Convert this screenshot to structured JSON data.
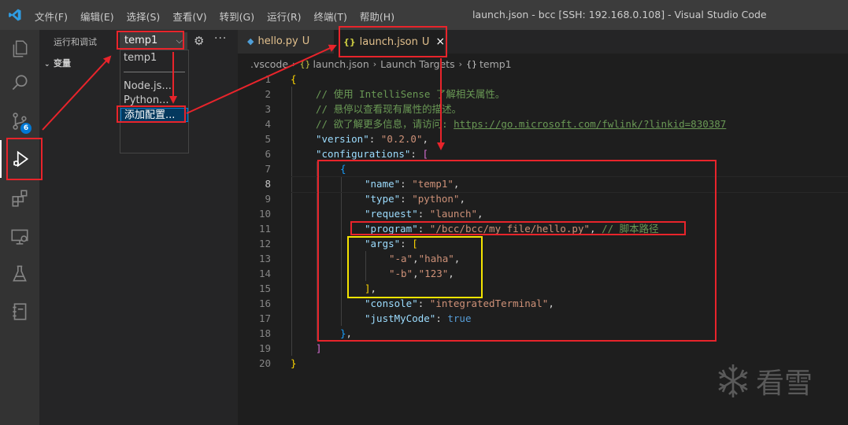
{
  "titlebar": {
    "menu": [
      "文件(F)",
      "编辑(E)",
      "选择(S)",
      "查看(V)",
      "转到(G)",
      "运行(R)",
      "终端(T)",
      "帮助(H)"
    ],
    "window_title": "launch.json - bcc [SSH: 192.168.0.108] - Visual Studio Code"
  },
  "activity_bar": {
    "items": [
      "explorer-icon",
      "search-icon",
      "source-control-icon",
      "run-debug-icon",
      "extensions-icon",
      "remote-explorer-icon",
      "testing-icon",
      "notebook-icon"
    ],
    "source_control_badge": "6"
  },
  "sidebar": {
    "title": "运行和调试",
    "config_selected": "temp1",
    "variables_section": "变量",
    "dropdown": {
      "items": [
        "temp1",
        "Node.js...",
        "Python...",
        "添加配置..."
      ]
    }
  },
  "tabs": [
    {
      "icon": "python-icon",
      "label": "hello.py",
      "status": "U"
    },
    {
      "icon": "json-icon",
      "label": "launch.json",
      "status": "U",
      "close": "×"
    }
  ],
  "breadcrumb": [
    ".vscode",
    "launch.json",
    "Launch Targets",
    "temp1"
  ],
  "editor": {
    "line_numbers": [
      "1",
      "2",
      "3",
      "4",
      "5",
      "6",
      "7",
      "8",
      "9",
      "10",
      "11",
      "12",
      "13",
      "14",
      "15",
      "16",
      "17",
      "18",
      "19",
      "20"
    ],
    "lines": {
      "l1": "{",
      "l2": "// 使用 IntelliSense 了解相关属性。",
      "l3": "// 悬停以查看现有属性的描述。",
      "l4_comment": "// 欲了解更多信息，请访问: ",
      "l4_link": "https://go.microsoft.com/fwlink/?linkid=830387",
      "version_key": "\"version\"",
      "version_val": "\"0.2.0\"",
      "configurations_key": "\"configurations\"",
      "open_bracket": "[",
      "l7": "{",
      "name_key": "\"name\"",
      "name_val": "\"temp1\"",
      "type_key": "\"type\"",
      "type_val": "\"python\"",
      "request_key": "\"request\"",
      "request_val": "\"launch\"",
      "program_key": "\"program\"",
      "program_val": "\"/bcc/bcc/my file/hello.py\"",
      "program_comment": "// 脚本路径",
      "args_key": "\"args\"",
      "args_open": "[",
      "arg_a": "\"-a\"",
      "arg_haha": "\"haha\"",
      "arg_b": "\"-b\"",
      "arg_123": "\"123\"",
      "args_close": "]",
      "console_key": "\"console\"",
      "console_val": "\"integratedTerminal\"",
      "justmycode_key": "\"justMyCode\"",
      "justmycode_val": "true",
      "l18": "}",
      "l19": "]",
      "l20": "}"
    }
  },
  "watermark": {
    "text": "看雪"
  },
  "annotation_colors": {
    "red": "#e8242b",
    "yellow": "#f5e400"
  }
}
